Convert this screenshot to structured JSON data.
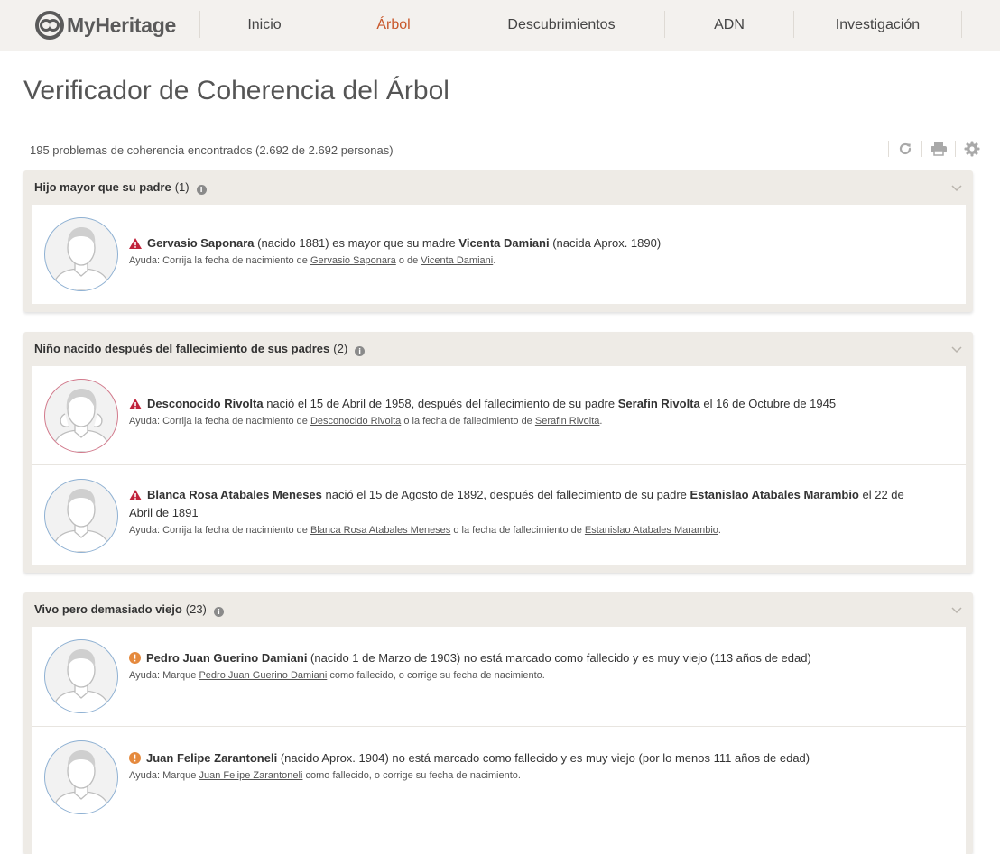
{
  "nav": {
    "logo_text": "MyHeritage",
    "items": [
      {
        "label": "Inicio"
      },
      {
        "label": "Árbol"
      },
      {
        "label": "Descubrimientos"
      },
      {
        "label": "ADN"
      },
      {
        "label": "Investigación"
      }
    ],
    "active_index": 1
  },
  "page": {
    "title": "Verificador de Coherencia del Árbol",
    "summary": "195 problemas de coherencia encontrados (2.692 de 2.692 personas)"
  },
  "tools": [
    "refresh-icon",
    "print-icon",
    "gear-icon"
  ],
  "colors": {
    "accent": "#c8572a",
    "error": "#c0223b",
    "warning": "#e58a3e",
    "male_border": "#8fb1d3",
    "female_border": "#d27a8c"
  },
  "sections": [
    {
      "title": "Hijo mayor que su padre",
      "count": "(1)",
      "issues": [
        {
          "severity": "error",
          "gender": "male",
          "t1": "Gervasio Saponara",
          "t2": " (nacido 1881) es mayor que su madre ",
          "t3": "Vicenta Damiani",
          "t4": " (nacida Aprox. 1890)",
          "t5": "",
          "t6": "",
          "help_prefix": "Ayuda: Corrija la fecha de nacimiento de ",
          "link1": "Gervasio Saponara",
          "help_mid": " o de ",
          "link2": "Vicenta Damiani",
          "help_suffix": "."
        }
      ]
    },
    {
      "title": "Niño nacido después del fallecimiento de sus padres",
      "count": "(2)",
      "issues": [
        {
          "severity": "error",
          "gender": "female",
          "t1": "Desconocido Rivolta",
          "t2": " nació el 15 de Abril de 1958, después del fallecimiento de su padre ",
          "t3": "Serafin Rivolta",
          "t4": " el 16 de Octubre de 1945",
          "help_prefix": "Ayuda: Corrija la fecha de nacimiento de ",
          "link1": "Desconocido Rivolta",
          "help_mid": " o la fecha de fallecimiento de ",
          "link2": "Serafin Rivolta",
          "help_suffix": "."
        },
        {
          "severity": "error",
          "gender": "male",
          "t1": "Blanca Rosa Atabales Meneses",
          "t2": " nació el 15 de Agosto de 1892, después del fallecimiento de su padre ",
          "t3": "Estanislao Atabales Marambio",
          "t4": " el 22 de Abril de 1891",
          "help_prefix": "Ayuda: Corrija la fecha de nacimiento de ",
          "link1": "Blanca Rosa Atabales Meneses",
          "help_mid": " o la fecha de fallecimiento de ",
          "link2": "Estanislao Atabales Marambio",
          "help_suffix": "."
        }
      ]
    },
    {
      "title": "Vivo pero demasiado viejo",
      "count": "(23)",
      "issues": [
        {
          "severity": "warning",
          "gender": "male",
          "t1": "Pedro Juan Guerino Damiani",
          "t2": " (nacido 1 de Marzo de 1903) no está marcado como fallecido y es muy viejo (113 años de edad)",
          "help_prefix": "Ayuda: Marque ",
          "link1": "Pedro Juan Guerino Damiani",
          "help_mid": " como fallecido, o corrige su fecha de nacimiento.",
          "link2": "",
          "help_suffix": ""
        },
        {
          "severity": "warning",
          "gender": "male",
          "t1": "Juan Felipe Zarantoneli",
          "t2": " (nacido Aprox. 1904) no está marcado como fallecido y es muy viejo (por lo menos 111 años de edad)",
          "help_prefix": "Ayuda: Marque ",
          "link1": "Juan Felipe Zarantoneli",
          "help_mid": " como fallecido, o corrige su fecha de nacimiento.",
          "link2": "",
          "help_suffix": ""
        }
      ]
    }
  ]
}
